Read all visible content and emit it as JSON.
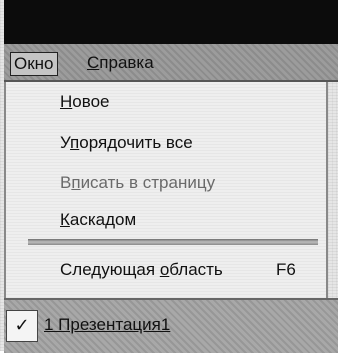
{
  "menubar": {
    "okno": "Окно",
    "spravka_mnemonic": "С",
    "spravka_rest": "правка"
  },
  "dropdown": {
    "items": [
      {
        "mnemonic": "Н",
        "rest": "овое",
        "disabled": false
      },
      {
        "pre": "У",
        "mnemonic": "п",
        "rest": "орядочить все",
        "disabled": false
      },
      {
        "pre": "В",
        "mnemonic": "п",
        "rest": "исать в страницу",
        "disabled": true
      },
      {
        "mnemonic": "К",
        "rest": "аскадом",
        "disabled": false
      }
    ],
    "next_area": {
      "pre": "Следующая ",
      "mnemonic": "о",
      "rest": "бласть",
      "shortcut": "F6"
    },
    "open_window": {
      "checked": true,
      "check_glyph": "✓",
      "label": "1 Презентация1"
    }
  }
}
